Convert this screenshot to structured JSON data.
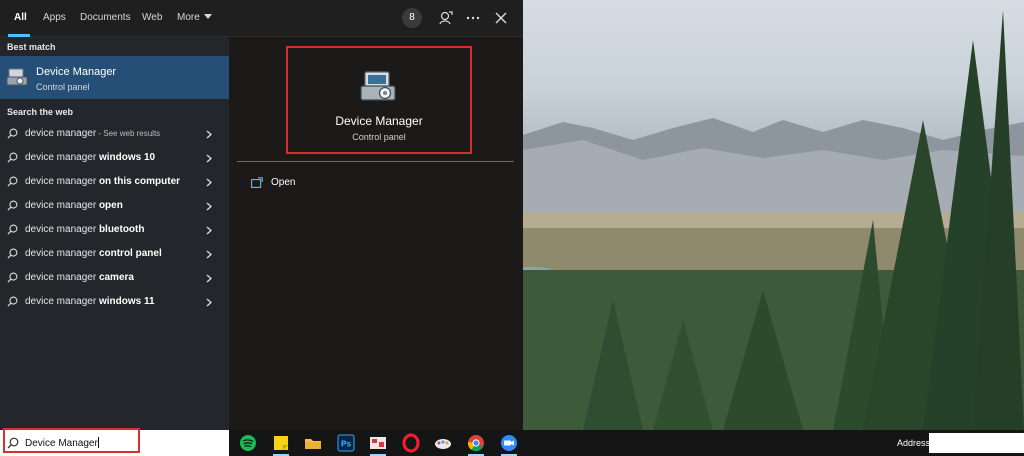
{
  "tabs": [
    "All",
    "Apps",
    "Documents",
    "Web",
    "More"
  ],
  "header": {
    "badge_count": "8"
  },
  "best_match": {
    "heading": "Best match",
    "title": "Device Manager",
    "subtitle": "Control panel"
  },
  "web": {
    "heading": "Search the web",
    "items": [
      {
        "prefix": "device manager",
        "bold": "",
        "suffix": " - See web results"
      },
      {
        "prefix": "device manager ",
        "bold": "windows 10",
        "suffix": ""
      },
      {
        "prefix": "device manager ",
        "bold": "on this computer",
        "suffix": ""
      },
      {
        "prefix": "device manager ",
        "bold": "open",
        "suffix": ""
      },
      {
        "prefix": "device manager ",
        "bold": "bluetooth",
        "suffix": ""
      },
      {
        "prefix": "device manager ",
        "bold": "control panel",
        "suffix": ""
      },
      {
        "prefix": "device manager ",
        "bold": "camera",
        "suffix": ""
      },
      {
        "prefix": "device manager ",
        "bold": "windows 11",
        "suffix": ""
      }
    ]
  },
  "preview": {
    "title": "Device Manager",
    "subtitle": "Control panel",
    "action_open": "Open"
  },
  "taskbar": {
    "search_value": "Device Manager",
    "address_label": "Address",
    "apps": [
      "spotify-icon",
      "sticky-notes-icon",
      "file-explorer-icon",
      "photoshop-icon",
      "snipping-tool-icon",
      "opera-icon",
      "paint-icon",
      "chrome-icon",
      "zoom-icon"
    ]
  },
  "colors": {
    "accent": "#4cc2ff",
    "selection": "#264f78",
    "highlight_box": "#d9302c"
  }
}
